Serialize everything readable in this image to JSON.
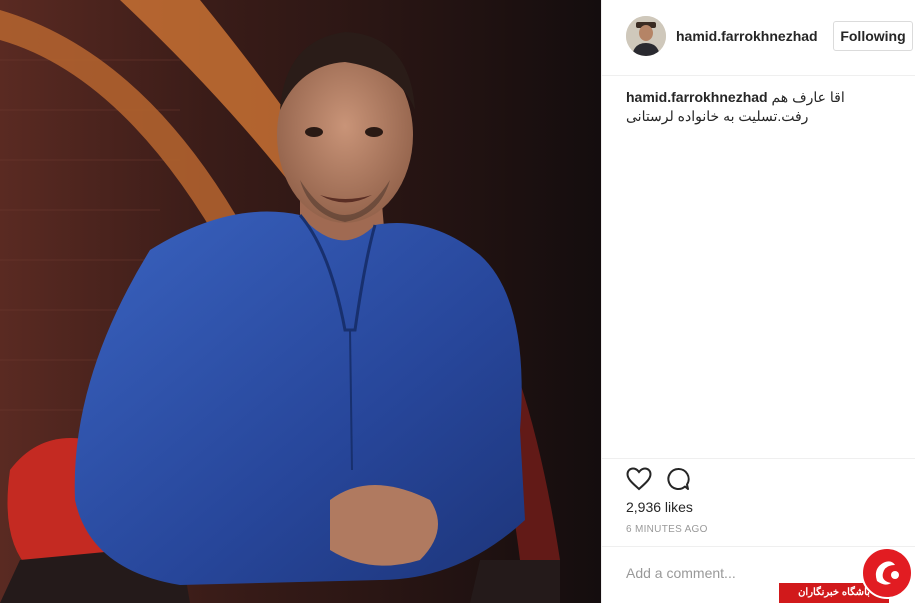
{
  "post": {
    "username": "hamid.farrokhnezhad",
    "follow_label": "Following",
    "caption_user": "hamid.farrokhnezhad",
    "caption_text": "اقا عارف هم رفت.تسلیت به خانواده لرستانی",
    "likes": "2,936 likes",
    "time_ago": "6 MINUTES AGO",
    "comment_placeholder": "Add a comment..."
  },
  "watermark": {
    "text": "باشگاه خبرنگاران"
  },
  "colors": {
    "shirt_blue": "#2b4fa6",
    "background_dark": "#1a1112",
    "watermark_red": "#d1191b",
    "text_dark": "#262626",
    "text_muted": "#999999"
  },
  "icons": [
    "heart-icon",
    "comment-icon"
  ]
}
